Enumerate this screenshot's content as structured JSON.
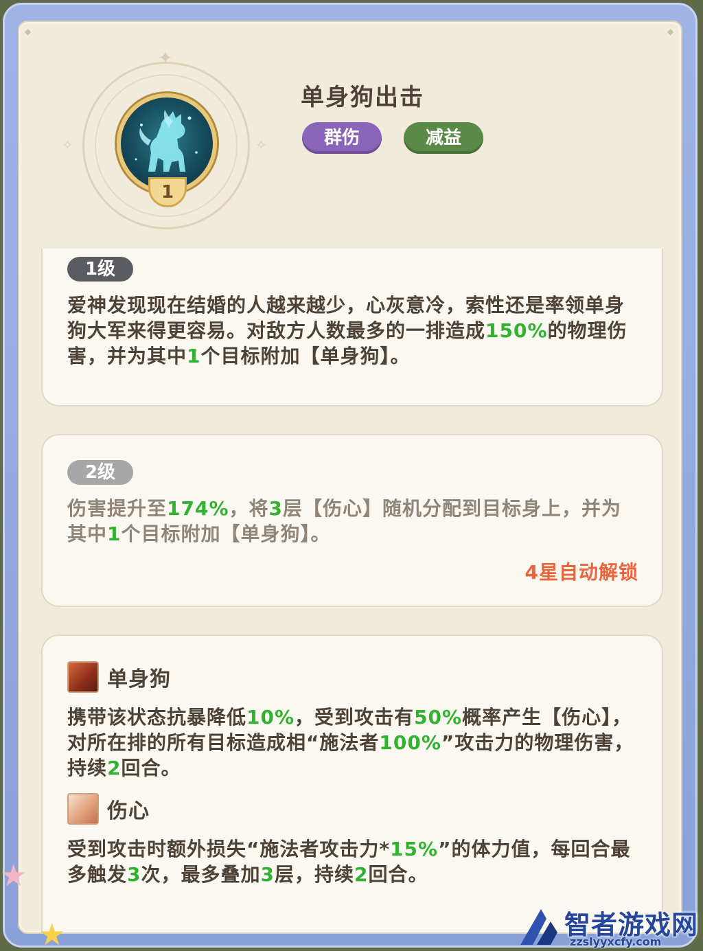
{
  "skill": {
    "title": "单身狗出击",
    "icon_level": "1",
    "tags": [
      "群伤",
      "减益"
    ]
  },
  "levels": [
    {
      "label": "1级",
      "unlocked": true,
      "description_parts": [
        {
          "text": "爱神发现现在结婚的人越来越少，心灰意冷，索性还是率领单身狗大军来得更容易。对敌方人数最多的一排造成",
          "hl": false
        },
        {
          "text": "150%",
          "hl": true
        },
        {
          "text": "的物理伤害，并为其中",
          "hl": false
        },
        {
          "text": "1",
          "hl": true
        },
        {
          "text": "个目标附加【单身狗】。",
          "hl": false
        }
      ]
    },
    {
      "label": "2级",
      "unlocked": false,
      "description_parts": [
        {
          "text": "伤害提升至",
          "hl": false
        },
        {
          "text": "174%",
          "hl": true
        },
        {
          "text": "，将",
          "hl": false
        },
        {
          "text": "3",
          "hl": true
        },
        {
          "text": "层【伤心】随机分配到目标身上，并为其中",
          "hl": false
        },
        {
          "text": "1",
          "hl": true
        },
        {
          "text": "个目标附加【单身狗】。",
          "hl": false
        }
      ],
      "unlock_text": "4星自动解锁"
    }
  ],
  "statuses": [
    {
      "name": "单身狗",
      "icon": "dog-status-icon",
      "description_parts": [
        {
          "text": "携带该状态抗暴降低",
          "hl": false
        },
        {
          "text": "10%",
          "hl": true
        },
        {
          "text": "，受到攻击有",
          "hl": false
        },
        {
          "text": "50%",
          "hl": true
        },
        {
          "text": "概率产生【伤心】，对所在排的所有目标造成相“施法者",
          "hl": false
        },
        {
          "text": "100%",
          "hl": true
        },
        {
          "text": "”攻击力的物理伤害，持续",
          "hl": false
        },
        {
          "text": "2",
          "hl": true
        },
        {
          "text": "回合。",
          "hl": false
        }
      ]
    },
    {
      "name": "伤心",
      "icon": "heartbreak-status-icon",
      "description_parts": [
        {
          "text": "受到攻击时额外损失“施法者攻击力*",
          "hl": false
        },
        {
          "text": "15%",
          "hl": true
        },
        {
          "text": "”的体力值，每回合最多触发",
          "hl": false
        },
        {
          "text": "3",
          "hl": true
        },
        {
          "text": "次，最多叠加",
          "hl": false
        },
        {
          "text": "3",
          "hl": true
        },
        {
          "text": "层，持续",
          "hl": false
        },
        {
          "text": "2",
          "hl": true
        },
        {
          "text": "回合。",
          "hl": false
        }
      ]
    }
  ],
  "watermark": {
    "name": "智者游戏网",
    "url": "zzslyyxcfy.com"
  },
  "colors": {
    "highlight": "#31b331",
    "unlock": "#e9653e",
    "tag_purple": "#8a64b8",
    "tag_green": "#5b8a48",
    "frame_blue": "#8aa1d8",
    "panel": "#f1ebdc"
  }
}
